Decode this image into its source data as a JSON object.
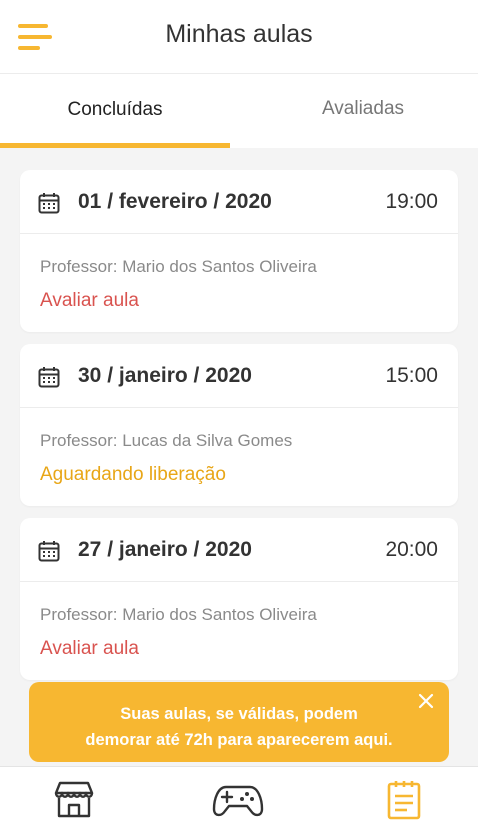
{
  "header": {
    "title": "Minhas aulas",
    "menu_icon": "hamburger-menu-icon"
  },
  "tabs": [
    {
      "label": "Concluídas",
      "active": true
    },
    {
      "label": "Avaliadas",
      "active": false
    }
  ],
  "cards": [
    {
      "date": "01 / fevereiro / 2020",
      "time": "19:00",
      "professor": "Professor: Mario dos Santos Oliveira",
      "action": "Avaliar aula",
      "action_color": "#d9534f"
    },
    {
      "date": "30 / janeiro / 2020",
      "time": "15:00",
      "professor": "Professor: Lucas da Silva Gomes",
      "action": "Aguardando liberação",
      "action_color": "#e8a617"
    },
    {
      "date": "27 / janeiro / 2020",
      "time": "20:00",
      "professor": "Professor: Mario dos Santos Oliveira",
      "action": "Avaliar aula",
      "action_color": "#d9534f"
    }
  ],
  "toast": {
    "line1": "Suas aulas, se válidas, podem",
    "line2": "demorar até 72h para aparecerem aqui."
  },
  "bottom_nav": [
    {
      "icon": "store-icon",
      "active": false
    },
    {
      "icon": "gamepad-icon",
      "active": false
    },
    {
      "icon": "clipboard-list-icon",
      "active": true
    }
  ],
  "colors": {
    "accent": "#f7b731",
    "danger": "#d9534f",
    "warning": "#e8a617"
  }
}
